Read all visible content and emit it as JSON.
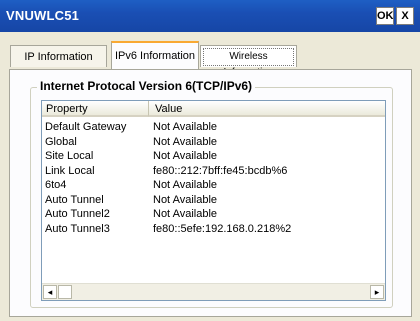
{
  "window": {
    "title": "VNUWLC51",
    "ok_label": "OK",
    "close_label": "X"
  },
  "tabs": [
    {
      "label": "IP Information"
    },
    {
      "label": "IPv6 Information",
      "selected": true
    },
    {
      "label": "Wireless Information"
    }
  ],
  "group": {
    "title": "Internet Protocal Version 6(TCP/IPv6)"
  },
  "table": {
    "columns": [
      "Property",
      "Value"
    ],
    "rows": [
      {
        "property": "Default Gateway",
        "value": "Not Available"
      },
      {
        "property": "Global",
        "value": "Not Available"
      },
      {
        "property": "Site Local",
        "value": "Not Available"
      },
      {
        "property": "Link Local",
        "value": "fe80::212:7bff:fe45:bcdb%6"
      },
      {
        "property": "6to4",
        "value": "Not Available"
      },
      {
        "property": "Auto Tunnel",
        "value": "Not Available"
      },
      {
        "property": "Auto Tunnel2",
        "value": "Not Available"
      },
      {
        "property": "Auto Tunnel3",
        "value": "fe80::5efe:192.168.0.218%2"
      }
    ]
  },
  "scrollbar": {
    "left_arrow": "◂",
    "right_arrow": "▸"
  },
  "colors": {
    "titlebar": "#1a4fb4",
    "tab_highlight": "#f9a932",
    "client_bg": "#ece9d8"
  }
}
